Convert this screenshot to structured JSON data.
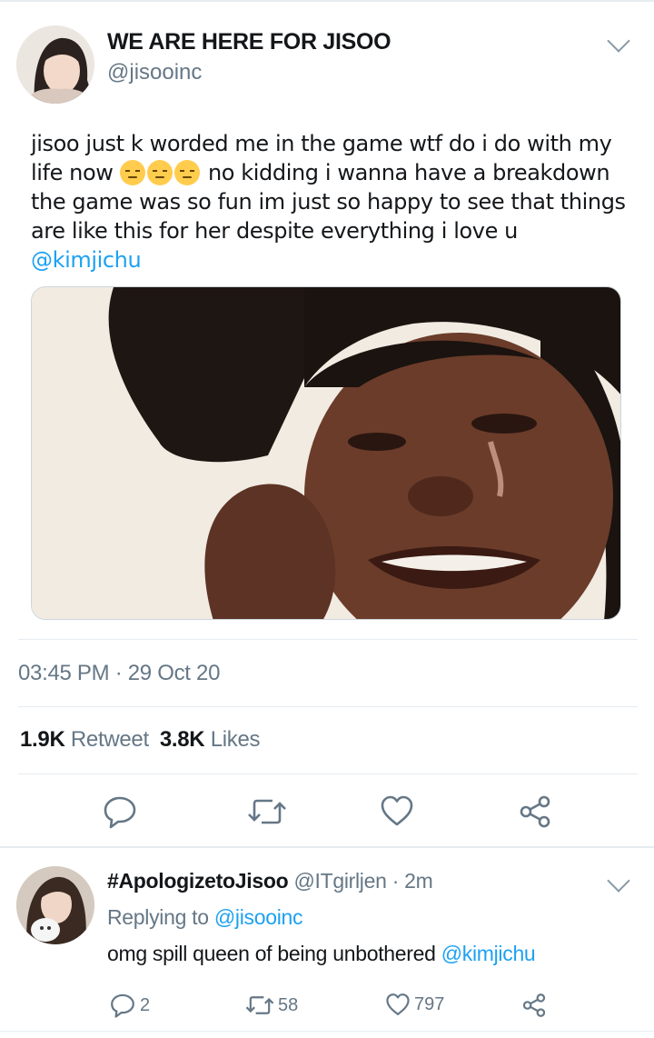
{
  "tweet": {
    "display_name": "WE ARE HERE FOR JISOO",
    "handle": "@jisooinc",
    "text_part1": "jisoo just k worded me in the game wtf do i do with my life now ",
    "text_part2": " no kidding i wanna have a breakdown the game was so fun im just so happy to see that things are like this for her despite everything i love u ",
    "mention": "@kimjichu",
    "emoji_icon": "pensive-face-emoji",
    "timestamp": "03:45 PM · 29 Oct 20",
    "retweet_count": "1.9K",
    "retweet_label": "Retweet",
    "like_count": "3.8K",
    "like_label": "Likes"
  },
  "reply": {
    "display_name": "#ApologizetoJisoo",
    "handle_time": "@ITgirljen · 2m",
    "replying_prefix": "Replying to ",
    "replying_to": "@jisooinc",
    "text": "omg spill queen of being unbothered ",
    "mention": "@kimjichu",
    "reply_count": "2",
    "retweet_count": "58",
    "like_count": "797"
  },
  "colors": {
    "accent": "#1da1f2",
    "secondary_text": "#657786",
    "icon_gray": "#8899a6"
  }
}
